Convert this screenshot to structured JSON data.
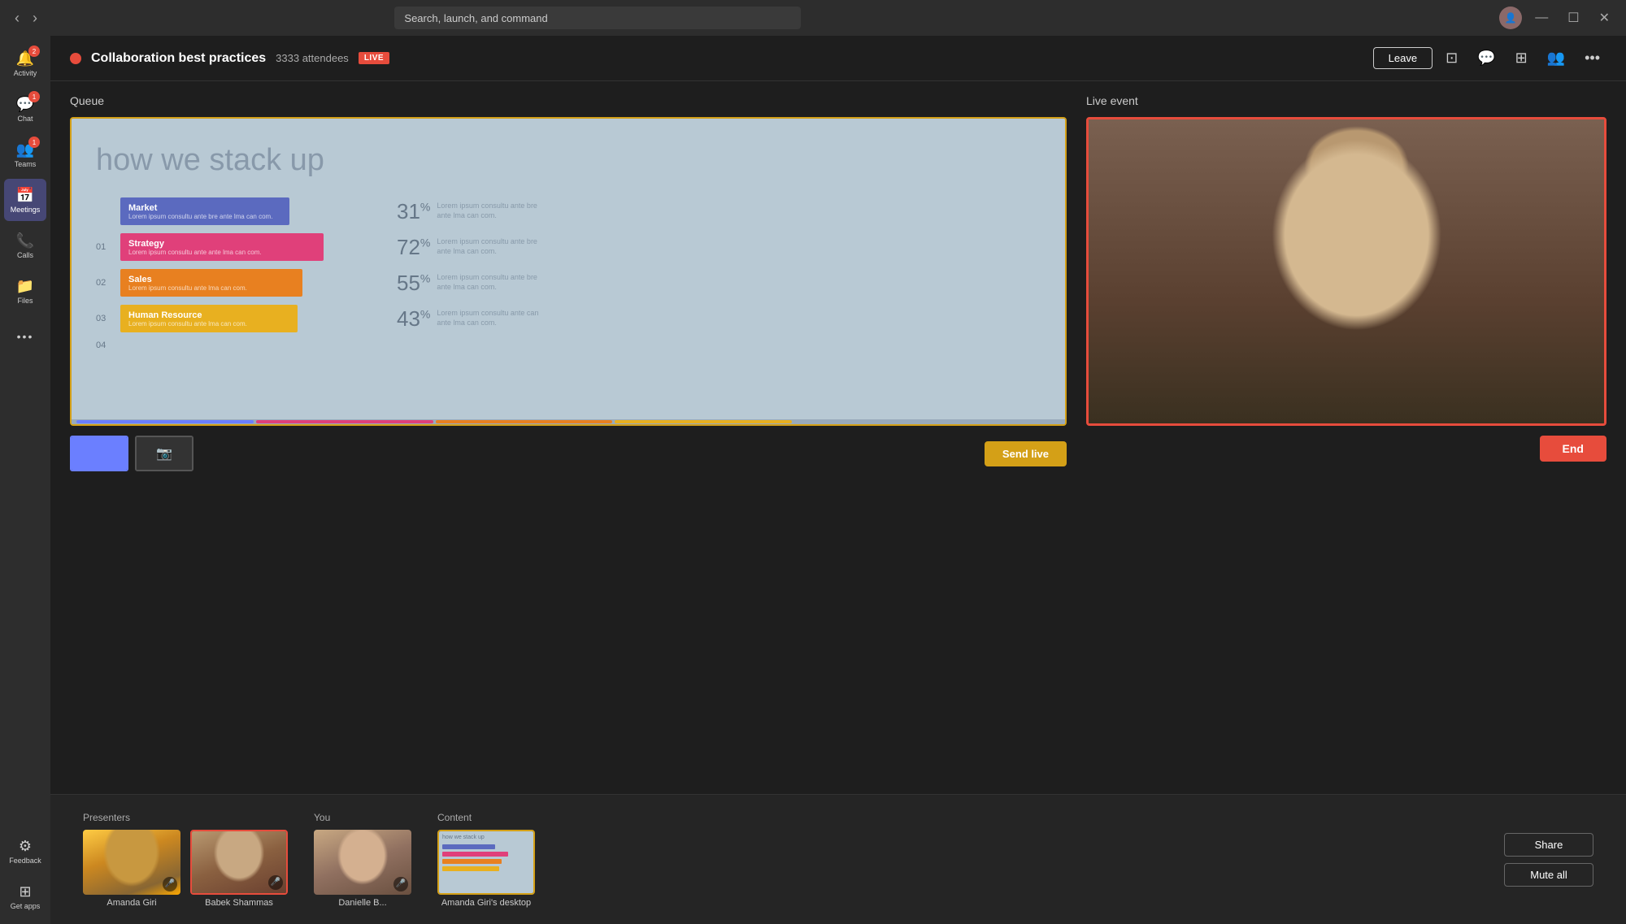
{
  "titleBar": {
    "searchPlaceholder": "Search, launch, and command"
  },
  "sidebar": {
    "items": [
      {
        "id": "activity",
        "label": "Activity",
        "icon": "🔔",
        "badge": "2"
      },
      {
        "id": "chat",
        "label": "Chat",
        "icon": "💬",
        "badge": "1"
      },
      {
        "id": "teams",
        "label": "Teams",
        "icon": "👥",
        "badge": "1"
      },
      {
        "id": "meetings",
        "label": "Meetings",
        "icon": "📅",
        "badge": null,
        "active": true
      },
      {
        "id": "calls",
        "label": "Calls",
        "icon": "📞",
        "badge": null
      },
      {
        "id": "files",
        "label": "Files",
        "icon": "📁",
        "badge": null
      },
      {
        "id": "more",
        "label": "...",
        "icon": "•••",
        "badge": null
      }
    ],
    "bottom": [
      {
        "id": "feedback",
        "label": "Feedback",
        "icon": "⚙"
      },
      {
        "id": "getapps",
        "label": "Get apps",
        "icon": "⊞"
      }
    ]
  },
  "topBar": {
    "eventTitle": "Collaboration best practices",
    "attendees": "3333 attendees",
    "liveBadge": "LIVE",
    "leaveBtn": "Leave",
    "endBtn": "End"
  },
  "queue": {
    "title": "Queue",
    "slide": {
      "headline": "how we stack up",
      "bars": [
        {
          "label": "Market",
          "sublabel": "Lorem ipsum consultu ante bre\nante lma can com.",
          "color": "#5b6abf",
          "width": "65%",
          "percent": "31",
          "desc": "Lorem ipsum consultu ante bre\nante lma can com."
        },
        {
          "num": "01",
          "label": "Strategy",
          "sublabel": "Lorem ipsum consultu ante\nante lma can com.",
          "color": "#e0407a",
          "width": "78%",
          "percent": "72",
          "desc": "Lorem ipsum consultu ante bre\nante lma can com."
        },
        {
          "num": "02",
          "label": "Sales",
          "sublabel": "Lorem ipsum consultu\nante lma can com.",
          "color": "#e88020",
          "width": "70%",
          "percent": "55",
          "desc": "Lorem ipsum consultu ante bre\nante lma can com."
        },
        {
          "num": "03",
          "label": "Human Resource",
          "sublabel": "Lorem ipsum consultu\nante lma can com.",
          "color": "#e8b020",
          "width": "68%",
          "percent": "43",
          "desc": "Lorem ipsum consultu ante can\nante lma can com."
        },
        {
          "num": "04"
        }
      ]
    },
    "sendLiveBtn": "Send live"
  },
  "liveEvent": {
    "title": "Live event",
    "endBtn": "End"
  },
  "presenters": {
    "sectionLabel": "Presenters",
    "items": [
      {
        "name": "Amanda Giri",
        "micMuted": false
      },
      {
        "name": "Babek Shammas",
        "micMuted": false,
        "active": true
      }
    ]
  },
  "you": {
    "sectionLabel": "You",
    "items": [
      {
        "name": "Danielle B...",
        "micMuted": true
      }
    ]
  },
  "content": {
    "sectionLabel": "Content",
    "items": [
      {
        "name": "Amanda Giri's desktop"
      }
    ]
  },
  "bottomRight": {
    "shareBtn": "Share",
    "muteAllBtn": "Mute all"
  }
}
